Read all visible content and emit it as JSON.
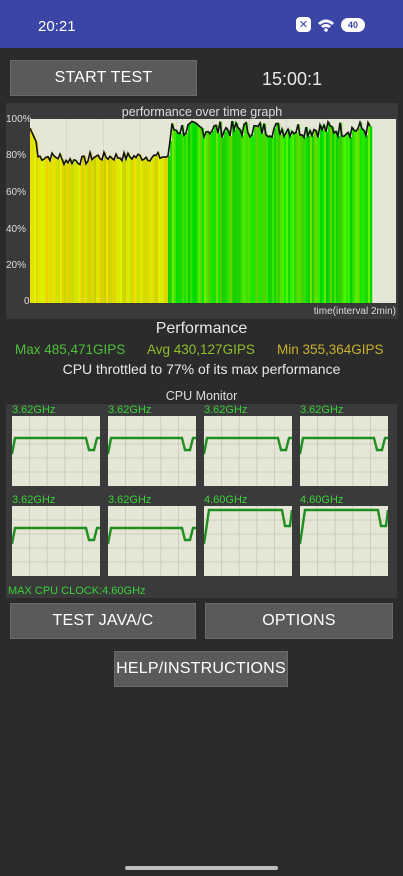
{
  "status_bar": {
    "time": "20:21",
    "x_badge": "✕",
    "battery": "40",
    "icons": [
      "x-notification-icon",
      "wifi-icon",
      "battery-icon"
    ]
  },
  "controls": {
    "start_label": "START TEST",
    "timer": "15:00:1",
    "java_label": "TEST JAVA/C",
    "options_label": "OPTIONS",
    "help_label": "HELP/INSTRUCTIONS"
  },
  "graph": {
    "title": "performance over time graph",
    "y_ticks": [
      "100%",
      "80%",
      "60%",
      "40%",
      "20%",
      "0"
    ],
    "x_caption": "time(interval 2min)"
  },
  "performance": {
    "title": "Performance",
    "max": "Max 485,471GIPS",
    "avg": "Avg 430,127GIPS",
    "min": "Min 355,364GIPS",
    "throttle": "CPU throttled to 77% of its max performance"
  },
  "cpu_monitor": {
    "title": "CPU Monitor",
    "cores": [
      {
        "freq": "3.62GHz"
      },
      {
        "freq": "3.62GHz"
      },
      {
        "freq": "3.62GHz"
      },
      {
        "freq": "3.62GHz"
      },
      {
        "freq": "3.62GHz"
      },
      {
        "freq": "3.62GHz"
      },
      {
        "freq": "4.60GHz"
      },
      {
        "freq": "4.60GHz"
      }
    ],
    "max_clock": "MAX CPU CLOCK:4.60GHz"
  },
  "colors": {
    "status_bar": "#3a45a6",
    "graph_bg": "#e6e6d6",
    "core_line": "#1f8f1f",
    "core_label": "#3ad23a"
  }
}
